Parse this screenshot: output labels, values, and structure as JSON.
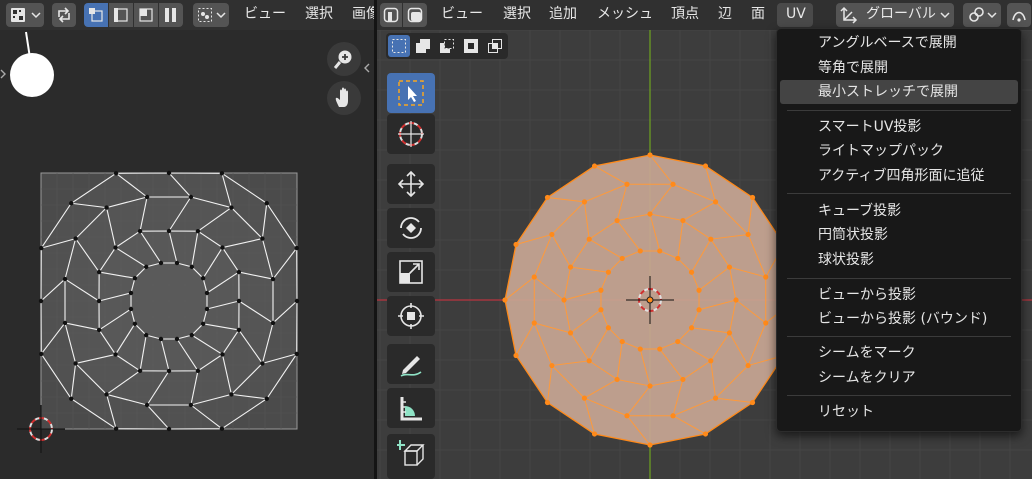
{
  "uv_editor": {
    "header": {
      "menus": [
        "ビュー",
        "選択",
        "画像"
      ]
    }
  },
  "viewport": {
    "header": {
      "menus": [
        "ビュー",
        "選択",
        "追加",
        "メッシュ",
        "頂点",
        "辺",
        "面",
        "UV"
      ],
      "transform_orientation": "グローバル"
    }
  },
  "uv_menu": {
    "groups": [
      [
        "アングルベースで展開",
        "等角で展開",
        "最小ストレッチで展開"
      ],
      [
        "スマートUV投影",
        "ライトマップパック",
        "アクティブ四角形面に追従"
      ],
      [
        "キューブ投影",
        "円筒状投影",
        "球状投影"
      ],
      [
        "ビューから投影",
        "ビューから投影 (バウンド)"
      ],
      [
        "シームをマーク",
        "シームをクリア"
      ],
      [
        "リセット"
      ]
    ],
    "highlighted": "最小ストレッチで展開"
  },
  "colors": {
    "header_bg": "#303030",
    "uv_bg": "#2b2b2b",
    "viewport_bg": "#3d3d3d",
    "accent": "#4772b3",
    "mesh_fill": "#c8a694",
    "mesh_edge": "#ff8a1a",
    "x_axis": "#b8343f",
    "y_axis": "#6b9c22"
  }
}
